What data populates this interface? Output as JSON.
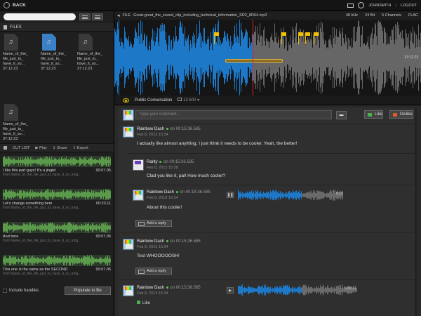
{
  "topbar": {
    "back": "BACK",
    "user": "JOHNSMITH",
    "logout": "LOGOUT"
  },
  "sidebar": {
    "search_placeholder": "",
    "files_header": "FILES",
    "files": [
      {
        "name": "Name_of_the_file_just_to_have_it_so...",
        "line1": "Name_of_the_",
        "line2": "file_just_to_",
        "line3": "have_it_so...",
        "time": "37:12.23",
        "selected": false
      },
      {
        "name": "Name_of_the_file_just_to_have_it_so...",
        "line1": "Name_of_the_",
        "line2": "file_just_to_",
        "line3": "have_it_so...",
        "time": "37:12.23",
        "selected": true
      },
      {
        "name": "Name_of_the_file_just_to_have_it_so...",
        "line1": "Name_of_the_",
        "line2": "file_just_to_",
        "line3": "have_it_so...",
        "time": "37:12.23",
        "selected": false
      },
      {
        "name": "Name_of_the_file_just_to_have_it_so...",
        "line1": "Name_of_the_",
        "line2": "file_just_to_",
        "line3": "have_it_so...",
        "time": "37:12.23",
        "selected": false
      }
    ],
    "cutlist": {
      "title": "CUT LIST",
      "play": "Play",
      "share": "Share",
      "export": "Export"
    },
    "clips": [
      {
        "title": "I like this part guys! It's a jingle!",
        "time": "00:07.05",
        "source": "from Name_of_the_file_just_to_have_it_so_long..."
      },
      {
        "title": "Let's change something here",
        "time": "00:23.11",
        "source": "from Name_of_the_file_just_to_have_it_so_long..."
      },
      {
        "title": "And here",
        "time": "00:07.05",
        "source": "from Name_of_the_file_just_to_have_it_so_long..."
      },
      {
        "title": "This one is the same as the SECOND",
        "time": "00:07.05",
        "source": "from Name_of_the_file_just_to_have_it_so_long..."
      }
    ],
    "include_handles": "Include handles",
    "populate": "Populate to file"
  },
  "player": {
    "file_label": "FILE",
    "filename": "Great-great_the_sound_clip_including_technical_information_SR2_8D64.mp3",
    "rate": "48 kHz",
    "bits": "24 Bit",
    "channels": "5 Channels",
    "format": "FLAC",
    "duration": "37:12.23",
    "conversation": "Public Conversation",
    "comments_count": "13 500"
  },
  "comments": {
    "placeholder": "Type your comment...",
    "like": "Like",
    "dislike": "Dislike",
    "items": [
      {
        "author": "Rainbow Dash",
        "on": "on 00:15:36.585",
        "date": "Feb 8, 2013 15:34",
        "text": "I actually like almost anything. I just think it needs to be cooler. Yeah, the better!"
      },
      {
        "author": "Rarity",
        "on": "on 00:15:36.585",
        "date": "Feb 8, 2013 15:38",
        "text": "Clad you like it, pal! How much cooler?"
      },
      {
        "author": "Rainbow Dash",
        "on": "on 00:15:36.585",
        "date": "Feb 8, 2013 15:34",
        "text": "About this cooler!",
        "clip_time": "0:10"
      },
      {
        "author": "Rainbow Dash",
        "on": "on 00:15:36.585",
        "date": "Feb 8, 2013 15:34",
        "text": "Test WHOOOOOSH!"
      },
      {
        "author": "Rainbow Dash",
        "on": "on 00:15:36.585",
        "date": "Feb 8, 2013 15:34",
        "clip_time": "5:30.12",
        "like_text": "Like"
      }
    ],
    "add_reply": "Add a reply"
  },
  "colors": {
    "accent_blue": "#1e78c8",
    "flag_yellow": "#f2c200",
    "playhead": "#e02020",
    "clip_green": "#5a9a4a"
  }
}
